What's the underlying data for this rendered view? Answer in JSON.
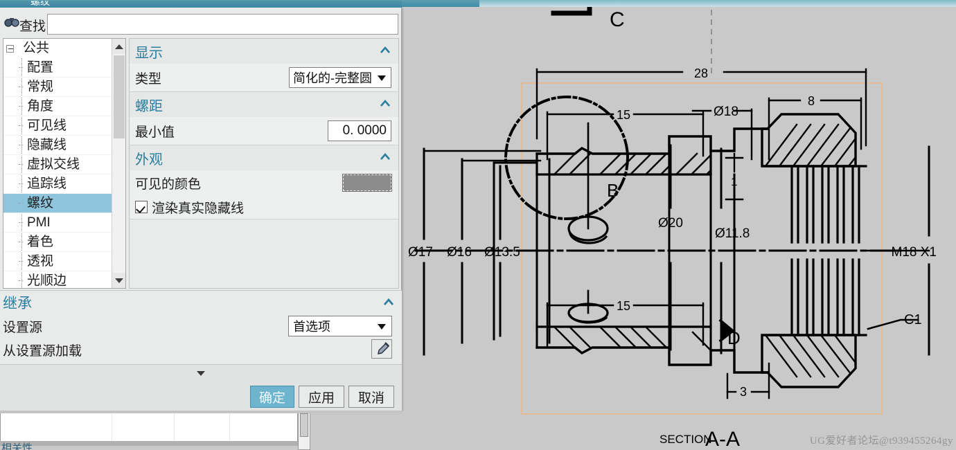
{
  "window": {
    "title": "螺纹"
  },
  "dialog": {
    "find": {
      "label": "查找",
      "icon": "binoculars-icon",
      "value": "",
      "placeholder": ""
    },
    "tree": {
      "root": "公共",
      "items": [
        "配置",
        "常规",
        "角度",
        "可见线",
        "隐藏线",
        "虚拟交线",
        "追踪线",
        "螺纹",
        "PMI",
        "着色",
        "透视",
        "光顺边"
      ],
      "selected": "螺纹"
    },
    "groups": [
      {
        "title": "显示",
        "rows": [
          {
            "label": "类型",
            "control": "combo",
            "value": "简化的-完整圆"
          }
        ]
      },
      {
        "title": "螺距",
        "rows": [
          {
            "label": "最小值",
            "control": "number",
            "value": "0. 0000"
          }
        ]
      },
      {
        "title": "外观",
        "rows": [
          {
            "label": "可见的颜色",
            "control": "swatch",
            "value": "#8c8c8c"
          },
          {
            "label": "渲染真实隐藏线",
            "control": "checkbox",
            "checked": true
          }
        ]
      }
    ],
    "inherit": {
      "title": "继承",
      "source_label": "设置源",
      "source_value": "首选项",
      "load_label": "从设置源加载",
      "eyedropper_icon": "eyedropper-icon"
    },
    "buttons": {
      "more_icon": "chevron-down-icon",
      "ok": "确定",
      "apply": "应用",
      "cancel": "取消"
    },
    "colors": {
      "heading": "#2a7e9e",
      "selection": "#8ec5dd",
      "primary_button": "#6eb4cf"
    }
  },
  "cad": {
    "section_prefix": "SECTION",
    "section_name": "A-A",
    "watermark": "UG爱好者论坛@t939455264gy",
    "labels": {
      "detail_c": "C",
      "detail_b": "B",
      "detail_d": "D",
      "chamfer_c1": "C1",
      "thread_spec": "M18  X1",
      "dim_28": "28",
      "dim_8": "8",
      "dim_15_top": "15",
      "dim_15_bottom": "15",
      "dim_1": "1",
      "dim_3": "3",
      "dia_18": "Ø18",
      "dia_20": "Ø20",
      "dia_11_8": "Ø11.8",
      "dia_17": "Ø17",
      "dia_16": "Ø16",
      "dia_13_5": "Ø13.5"
    }
  },
  "background": {
    "bottom_label": "相关性"
  }
}
